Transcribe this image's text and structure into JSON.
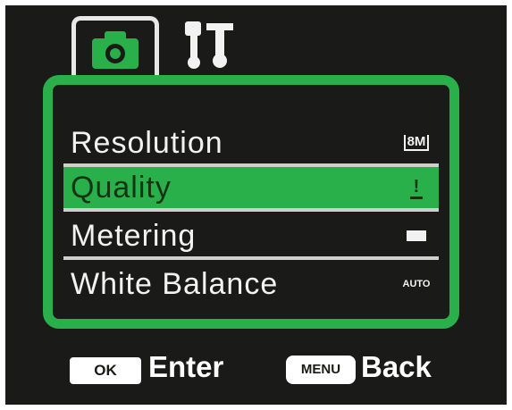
{
  "tabs": [
    {
      "icon": "camera-icon",
      "active": true
    },
    {
      "icon": "settings-wrench-icon",
      "active": false
    }
  ],
  "menu": {
    "items": [
      {
        "label": "Resolution",
        "value": "8M",
        "value_icon": "resolution-8m-icon"
      },
      {
        "label": "Quality",
        "value": "!",
        "value_icon": "quality-fine-icon"
      },
      {
        "label": "Metering",
        "value": "",
        "value_icon": "metering-average-icon"
      },
      {
        "label": "White Balance",
        "value": "AUTO",
        "value_icon": "white-balance-auto-icon"
      }
    ],
    "selected_index": 1
  },
  "hints": {
    "ok_key": "OK",
    "ok_text": "Enter",
    "menu_key": "MENU",
    "menu_text": "Back"
  },
  "colors": {
    "accent": "#2ab04a",
    "background": "#1a1a18",
    "text": "#f2f2f2"
  }
}
